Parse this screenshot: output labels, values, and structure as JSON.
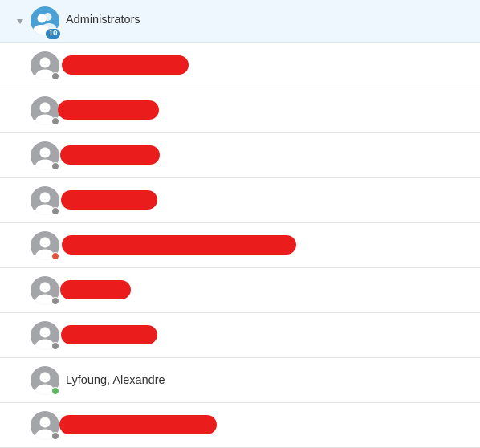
{
  "group": {
    "name": "Administrators",
    "member_count": "10",
    "expanded": true,
    "caret_icon": "caret-down-icon",
    "avatar_icon": "user-group-icon",
    "colors": {
      "header_bg": "#eef7fd",
      "avatar": "#4a9fd4",
      "badge": "#2d85c3"
    }
  },
  "members": [
    {
      "name": "",
      "redacted": true,
      "status": "offline"
    },
    {
      "name": "",
      "redacted": true,
      "status": "offline"
    },
    {
      "name": "",
      "redacted": true,
      "status": "offline"
    },
    {
      "name": "",
      "redacted": true,
      "status": "offline"
    },
    {
      "name": "",
      "redacted": true,
      "status": "busy"
    },
    {
      "name": "",
      "redacted": true,
      "status": "offline"
    },
    {
      "name": "",
      "redacted": true,
      "status": "offline"
    },
    {
      "name": "Lyfoung, Alexandre",
      "redacted": false,
      "status": "online"
    },
    {
      "name": "",
      "redacted": true,
      "status": "offline"
    }
  ],
  "status_colors": {
    "offline": "#8c8c8c",
    "busy": "#e8503a",
    "online": "#5cb85c"
  },
  "colors": {
    "redaction": "#ea1c1c",
    "avatar": "#a3a5a8"
  },
  "icons": {
    "member_avatar": "user-icon",
    "status": "status-dot"
  }
}
